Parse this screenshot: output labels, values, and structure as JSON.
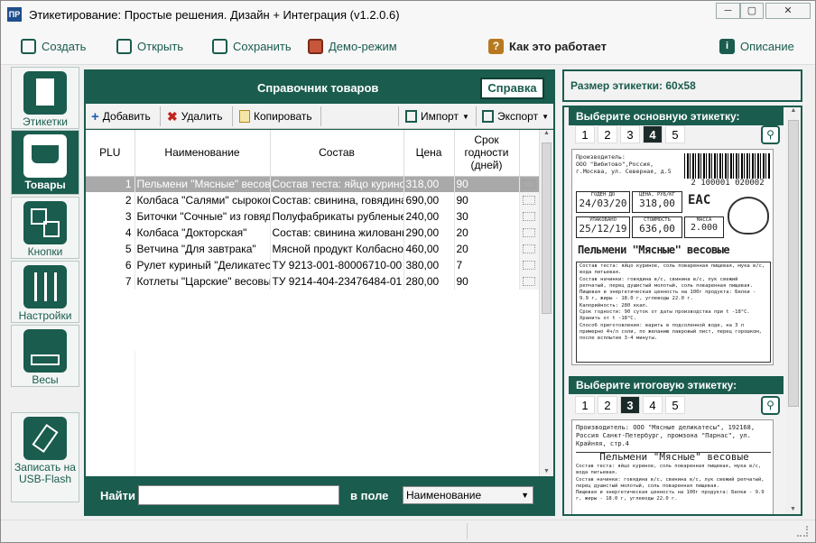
{
  "window": {
    "title": "Этикетирование: Простые решения. Дизайн + Интеграция (v1.2.0.6)",
    "min": "─",
    "max": "▢",
    "close": "✕"
  },
  "toolbar": {
    "create": "Создать",
    "open": "Открыть",
    "save": "Сохранить",
    "demo": "Демо-режим",
    "how": "Как это работает",
    "desc": "Описание"
  },
  "sidebar": [
    {
      "label": "Этикетки"
    },
    {
      "label": "Товары"
    },
    {
      "label": "Кнопки"
    },
    {
      "label": "Настройки"
    },
    {
      "label": "Весы"
    },
    {
      "label": "Записать на USB-Flash"
    }
  ],
  "catalog": {
    "title": "Справочник товаров",
    "help": "Справка",
    "add": "Добавить",
    "delete": "Удалить",
    "copy": "Копировать",
    "import": "Импорт",
    "export": "Экспорт",
    "columns": [
      "PLU",
      "Наименование",
      "Состав",
      "Цена",
      "Срок годности (дней)"
    ],
    "rows": [
      [
        "1",
        "Пельмени \"Мясные\" весовые",
        "Состав теста: яйцо куриное,",
        "318,00",
        "90"
      ],
      [
        "2",
        "Колбаса \"Салями\" сырокопче",
        "Состав: свинина, говядина,",
        "690,00",
        "90"
      ],
      [
        "3",
        "Биточки \"Сочные\" из говяди",
        "Полуфабрикаты рубленые м",
        "240,00",
        "30"
      ],
      [
        "4",
        "Колбаса \"Докторская\"",
        "Состав: свинина жилованная",
        "290,00",
        "20"
      ],
      [
        "5",
        "Ветчина \"Для завтрака\"",
        "Мясной продукт Колбасное и",
        "460,00",
        "20"
      ],
      [
        "6",
        "Рулет куриный \"Деликатесн",
        "ТУ 9213-001-80006710-00 Со",
        "380,00",
        "7"
      ],
      [
        "7",
        "Котлеты \"Царские\" весовые",
        "ТУ 9214-404-23476484-01 Со",
        "280,00",
        "90"
      ]
    ],
    "find": "Найти",
    "infield": "в поле",
    "field": "Наименование"
  },
  "right": {
    "size": "Размер этикетки:  60x58",
    "main": "Выберите основную этикетку:",
    "total": "Выберите итоговую этикетку:",
    "tabs": [
      "1",
      "2",
      "3",
      "4",
      "5"
    ]
  },
  "label1": {
    "maker": "Производитель:\nООО \"Вибитово\",Россия,\nг.Москва, ул. Северная, д.5",
    "barcode": "2 100001 020002",
    "h1": "ГОДЕН ДО",
    "d1": "24/03/20",
    "h2": "ЦЕНА, РУБ/КГ",
    "v2": "318,00",
    "eac": "ЕАС",
    "h3": "УПАКОВАНО",
    "d3": "25/12/19",
    "h4": "СТОИМОСТЬ",
    "v4": "636,00",
    "h5": "МАССА",
    "v5": "2.000",
    "name": "Пельмени \"Мясные\" весовые",
    "comp": "Состав теста: яйцо куриное, соль поваренная пищевая, мука в/с, вода питьевая.\nСостав начинки: говядина в/с, свинина в/с, лук свежий репчатый, перец душистый молотый, соль поваренная пищевая.\nПищевая и энергетическая ценность на 100г продукта: Белки - 9.9 г, жиры - 18.0 г, углеводы 22.0 г.\nКалорийность: 280 ккал.\nСрок годности: 90 суток от даты производства при t -18°С. Хранить от t -18°С.\nСпособ приготовления: варить в подсоленной воде, на 3 л примерно 4ч/л соли, по желанию лавровый лист, перец горошком, после всплытия 3-4 минуты."
  },
  "label2": {
    "maker": "Производитель: ООО \"Мясные деликатесы\", 192168, Россия Санкт-Петербург, промзона \"Парнас\", ул. Крайняя, стр.4",
    "name": "Пельмени \"Мясные\" весовые",
    "comp": "Состав теста: яйцо куриное, соль поваренная пищевая, мука в/с, вода питьевая.\nСостав начинки: говядина в/с, свинина в/с, лук свежий репчатый, перец душистый молотый, соль поваренная пищевая.\nПищевая и энергетическая ценность на 100г продукта: Белки - 9.9 г, жиры - 18.0 г, углеводы 22.0 г."
  }
}
